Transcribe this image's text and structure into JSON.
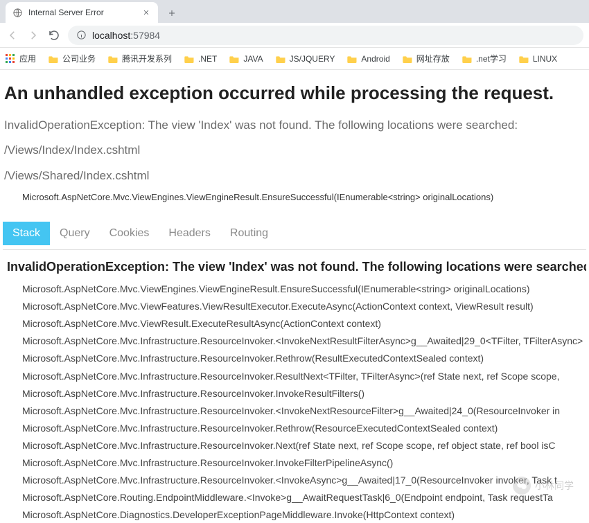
{
  "browser": {
    "tab_title": "Internal Server Error",
    "url_host": "localhost",
    "url_port": ":57984"
  },
  "bookmarks": {
    "apps_label": "应用",
    "items": [
      "公司业务",
      "腾讯开发系列",
      ".NET",
      "JAVA",
      "JS/JQUERY",
      "Android",
      "网址存放",
      ".net学习",
      "LINUX"
    ]
  },
  "error": {
    "heading": "An unhandled exception occurred while processing the request.",
    "message_line1": "InvalidOperationException: The view 'Index' was not found. The following locations were searched:",
    "message_line2": "/Views/Index/Index.cshtml",
    "message_line3": "/Views/Shared/Index.cshtml",
    "top_trace": "Microsoft.AspNetCore.Mvc.ViewEngines.ViewEngineResult.EnsureSuccessful(IEnumerable<string> originalLocations)"
  },
  "tabs": {
    "items": [
      "Stack",
      "Query",
      "Cookies",
      "Headers",
      "Routing"
    ],
    "active_index": 0
  },
  "stack": {
    "heading": "InvalidOperationException: The view 'Index' was not found. The following locations were searched:",
    "lines": [
      "Microsoft.AspNetCore.Mvc.ViewEngines.ViewEngineResult.EnsureSuccessful(IEnumerable<string> originalLocations)",
      "Microsoft.AspNetCore.Mvc.ViewFeatures.ViewResultExecutor.ExecuteAsync(ActionContext context, ViewResult result)",
      "Microsoft.AspNetCore.Mvc.ViewResult.ExecuteResultAsync(ActionContext context)",
      "Microsoft.AspNetCore.Mvc.Infrastructure.ResourceInvoker.<InvokeNextResultFilterAsync>g__Awaited|29_0<TFilter, TFilterAsync>",
      "Microsoft.AspNetCore.Mvc.Infrastructure.ResourceInvoker.Rethrow(ResultExecutedContextSealed context)",
      "Microsoft.AspNetCore.Mvc.Infrastructure.ResourceInvoker.ResultNext<TFilter, TFilterAsync>(ref State next, ref Scope scope,",
      "Microsoft.AspNetCore.Mvc.Infrastructure.ResourceInvoker.InvokeResultFilters()",
      "Microsoft.AspNetCore.Mvc.Infrastructure.ResourceInvoker.<InvokeNextResourceFilter>g__Awaited|24_0(ResourceInvoker in",
      "Microsoft.AspNetCore.Mvc.Infrastructure.ResourceInvoker.Rethrow(ResourceExecutedContextSealed context)",
      "Microsoft.AspNetCore.Mvc.Infrastructure.ResourceInvoker.Next(ref State next, ref Scope scope, ref object state, ref bool isC",
      "Microsoft.AspNetCore.Mvc.Infrastructure.ResourceInvoker.InvokeFilterPipelineAsync()",
      "Microsoft.AspNetCore.Mvc.Infrastructure.ResourceInvoker.<InvokeAsync>g__Awaited|17_0(ResourceInvoker invoker, Task t",
      "Microsoft.AspNetCore.Routing.EndpointMiddleware.<Invoke>g__AwaitRequestTask|6_0(Endpoint endpoint, Task requestTa",
      "Microsoft.AspNetCore.Diagnostics.DeveloperExceptionPageMiddleware.Invoke(HttpContext context)"
    ]
  },
  "watermark": {
    "text": "小林同学"
  }
}
